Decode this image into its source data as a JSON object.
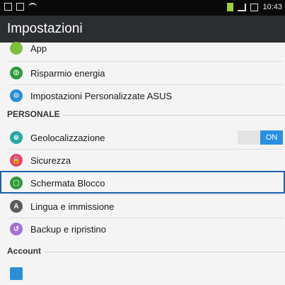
{
  "status_bar": {
    "time": "10:43",
    "icons": [
      "gallery-icon",
      "message-icon",
      "wifi-icon",
      "battery-icon"
    ]
  },
  "app_bar": {
    "title": "Impostazioni"
  },
  "list": {
    "items": [
      {
        "label": "App",
        "icon": "app-icon",
        "color": "#7bbf3a"
      },
      {
        "label": "Risparmio energia",
        "icon": "battery-save-icon",
        "color": "#2f9a3a"
      },
      {
        "label": "Impostazioni Personalizzate ASUS",
        "icon": "asus-custom-icon",
        "color": "#2c8fd6"
      }
    ],
    "section_personale": "PERSONALE",
    "personale_items": [
      {
        "label": "Geolocalizzazione",
        "icon": "location-icon",
        "color": "#2aa6a6",
        "toggle": "ON"
      },
      {
        "label": "Sicurezza",
        "icon": "lock-icon",
        "color": "#e4476f"
      },
      {
        "label": "Schermata Blocco",
        "icon": "lockscreen-icon",
        "color": "#2f9a3a"
      },
      {
        "label": "Lingua e immissione",
        "icon": "language-icon",
        "color": "#5b5b5b",
        "glyph": "A"
      },
      {
        "label": "Backup e ripristino",
        "icon": "backup-icon",
        "color": "#a46fd4"
      }
    ],
    "section_account": "Account"
  },
  "colors": {
    "accent": "#2a8fe2",
    "highlight_border": "#1f5fa8",
    "app_bar": "#2b2d30"
  }
}
